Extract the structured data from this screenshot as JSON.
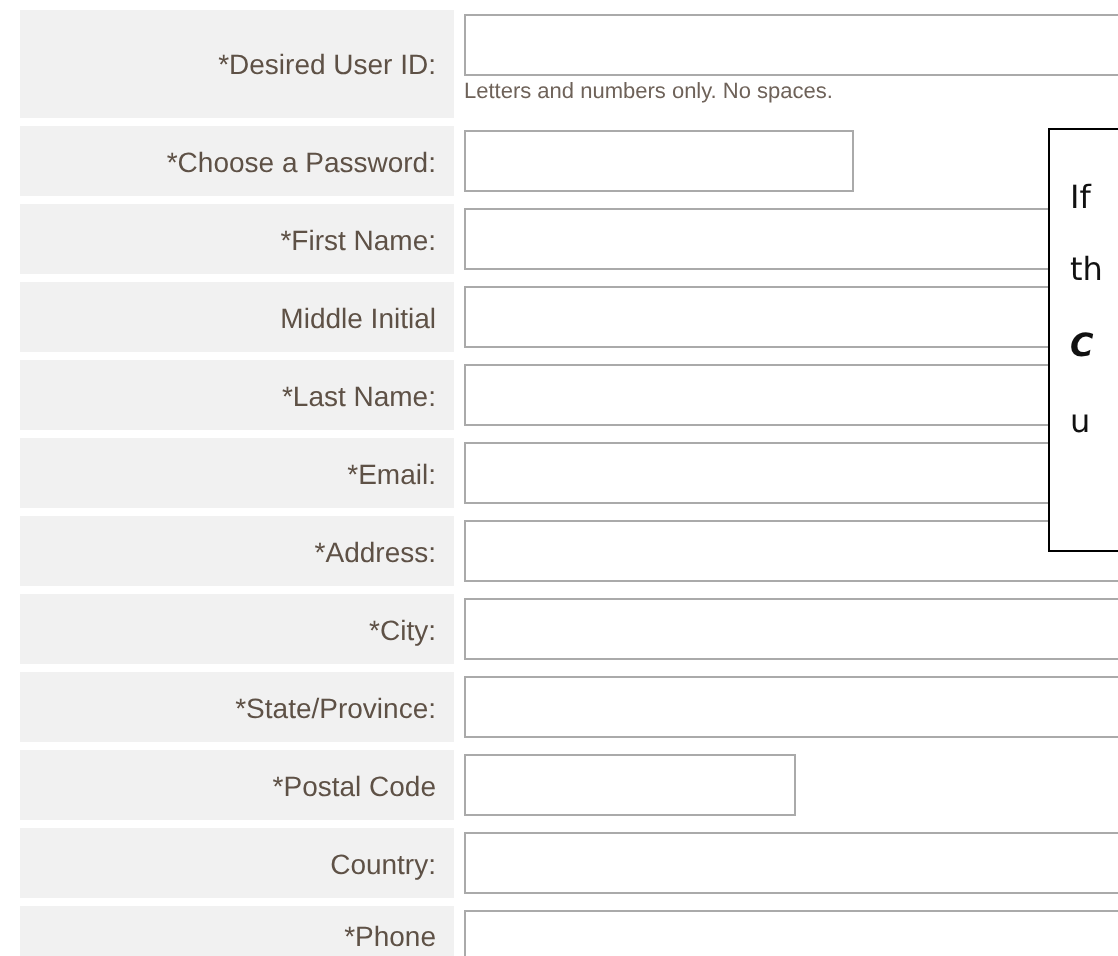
{
  "form": {
    "rows": [
      {
        "label": "*Desired User ID:",
        "kind": "wide",
        "hint": "Letters and numbers only. No spaces."
      },
      {
        "label": "*Choose a Password:",
        "kind": "medium"
      },
      {
        "label": "*First Name:",
        "kind": "wide"
      },
      {
        "label": "Middle Initial",
        "kind": "wide"
      },
      {
        "label": "*Last Name:",
        "kind": "wide"
      },
      {
        "label": "*Email:",
        "kind": "wide"
      },
      {
        "label": "*Address:",
        "kind": "wide"
      },
      {
        "label": "*City:",
        "kind": "wide"
      },
      {
        "label": "*State/Province:",
        "kind": "wide"
      },
      {
        "label": "*Postal Code",
        "kind": "short"
      },
      {
        "label": "Country:",
        "kind": "wide"
      },
      {
        "label": "*Phone",
        "kind": "wide"
      }
    ]
  },
  "callout": {
    "lines": [
      {
        "text": "If",
        "kind": "plain"
      },
      {
        "text": "th",
        "kind": "plain"
      },
      {
        "text": "C",
        "kind": "emphasis"
      },
      {
        "text": "u",
        "kind": "plain"
      }
    ]
  }
}
